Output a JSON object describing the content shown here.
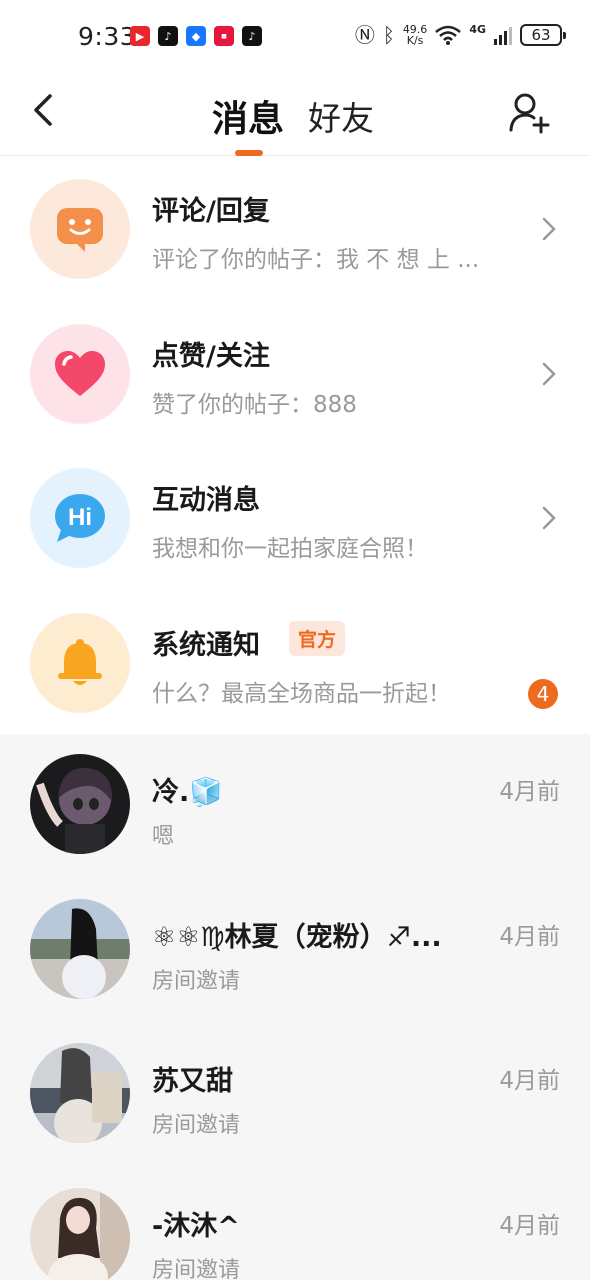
{
  "status_bar": {
    "time": "9:33",
    "net_speed_value": "49.6",
    "net_speed_unit": "K/s",
    "network": "4G",
    "battery": "63"
  },
  "header": {
    "tab_messages": "消息",
    "tab_friends": "好友",
    "accent_color": "#ee6a1f"
  },
  "categories": [
    {
      "title": "评论/回复",
      "subtitle": "评论了你的帖子：我 不 想 上 ...",
      "icon": "comment-bubble-icon",
      "icon_bg": "#fde8dc"
    },
    {
      "title": "点赞/关注",
      "subtitle": "赞了你的帖子：888",
      "icon": "heart-icon",
      "icon_bg": "#fde3e8"
    },
    {
      "title": "互动消息",
      "subtitle": "我想和你一起拍家庭合照！",
      "icon": "hi-bubble-icon",
      "icon_bg": "#e3f2fd"
    },
    {
      "title": "系统通知",
      "tag": "官方",
      "subtitle": "什么？最高全场商品一折起！",
      "badge": "4",
      "icon": "bell-icon",
      "icon_bg": "#fdeccf"
    }
  ],
  "conversations": [
    {
      "name": "冷.🧊",
      "time": "4月前",
      "message": "嗯"
    },
    {
      "name": "⚛⚛♍林夏（宠粉）♐...",
      "time": "4月前",
      "message": "房间邀请"
    },
    {
      "name": "苏又甜",
      "time": "4月前",
      "message": "房间邀请"
    },
    {
      "name": "-沐沐^",
      "time": "4月前",
      "message": "房间邀请"
    }
  ]
}
